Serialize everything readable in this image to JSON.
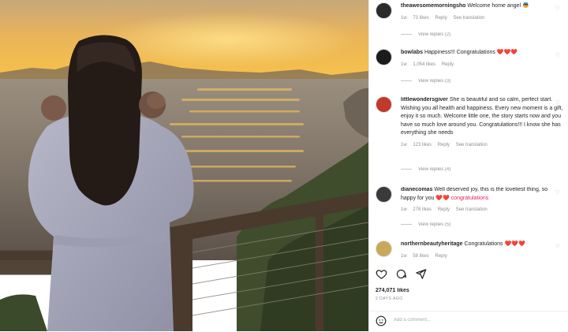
{
  "photo": {
    "description_icon": "sunset-photo"
  },
  "comments": [
    {
      "username": "theawesomemorningsho",
      "text": "Welcome home angel",
      "emoji": "👼",
      "meta": [
        "1w",
        "73 likes",
        "Reply",
        "See translation"
      ],
      "replies_label": "View replies (2)"
    },
    {
      "username": "bowlabs",
      "text": "Happiness!!! Congratulations",
      "emoji": "❤️❤️❤️",
      "meta": [
        "1w",
        "1,054 likes",
        "Reply"
      ],
      "replies_label": "View replies (3)"
    },
    {
      "username": "littlewondersgiver",
      "text": "She is beautiful and so calm, perfect start. Wishing you all health and happiness. Every new moment is a gift, enjoy it so much. Welcome little one, the story starts now and you have so much love around you. Congratulations!!! I know she has everything she needs",
      "emoji": "",
      "meta": [
        "1w",
        "123 likes",
        "Reply",
        "See translation"
      ],
      "replies_label": "View replies (4)"
    },
    {
      "username": "dianecomas",
      "text": "Well deserved joy, this is the loveliest thing, so happy for you",
      "emoji": "❤️❤️ congratulations",
      "meta": [
        "1w",
        "278 likes",
        "Reply",
        "See translation"
      ],
      "replies_label": "View replies (5)"
    },
    {
      "username": "northernbeautyheritage",
      "text": "Congratulations",
      "emoji": "❤️❤️❤️",
      "meta": [
        "1w",
        "58 likes",
        "Reply"
      ],
      "replies_label": ""
    }
  ],
  "likes_label": "274,071 likes",
  "date_label": "2 DAYS AGO",
  "add_comment_placeholder": "Add a comment..."
}
